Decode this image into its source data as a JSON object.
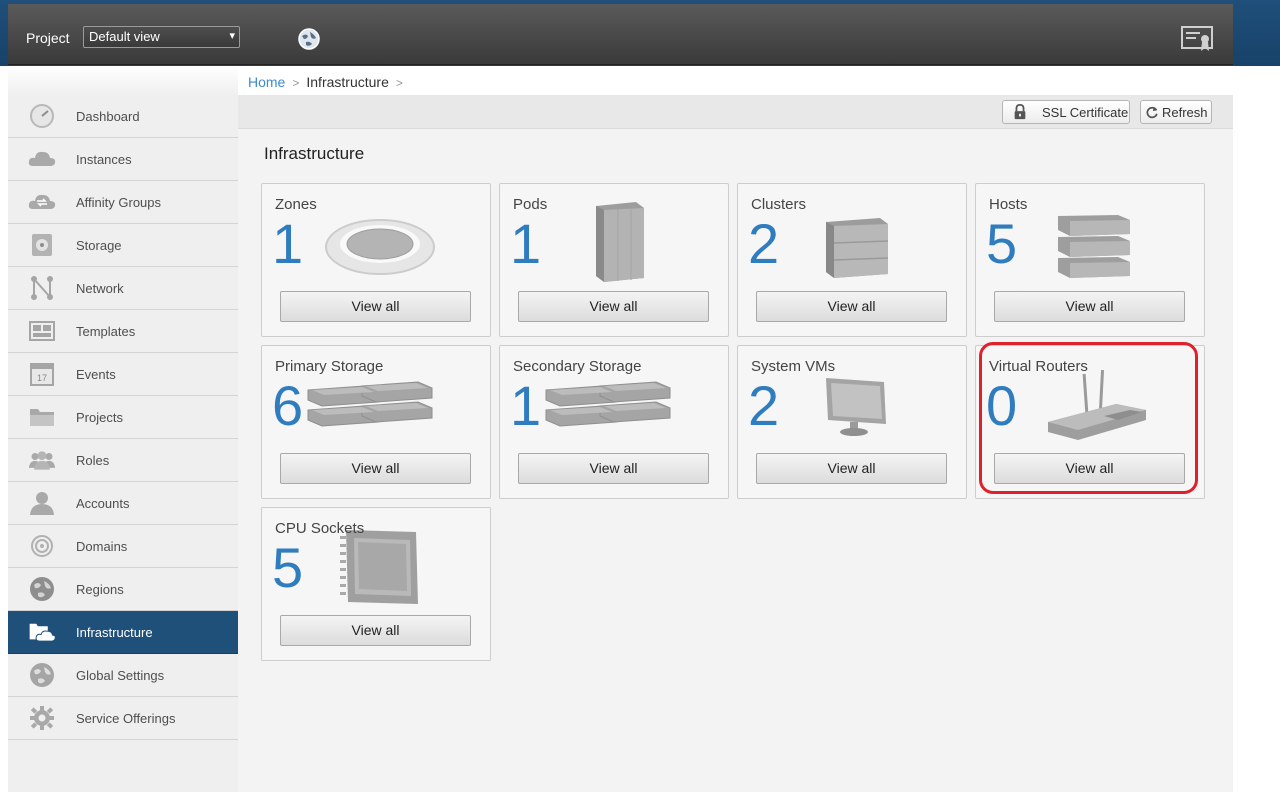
{
  "header": {
    "project_label": "Project",
    "project_select_value": "Default view",
    "caret": "▾",
    "accent_color": "#1e5079"
  },
  "sidebar": {
    "items": [
      {
        "label": "Dashboard",
        "icon": "dashboard-icon"
      },
      {
        "label": "Instances",
        "icon": "cloud-icon"
      },
      {
        "label": "Affinity Groups",
        "icon": "affinity-cloud-icon"
      },
      {
        "label": "Storage",
        "icon": "storage-disk-icon"
      },
      {
        "label": "Network",
        "icon": "network-icon"
      },
      {
        "label": "Templates",
        "icon": "templates-icon"
      },
      {
        "label": "Events",
        "icon": "calendar-icon"
      },
      {
        "label": "Projects",
        "icon": "folder-icon"
      },
      {
        "label": "Roles",
        "icon": "roles-icon"
      },
      {
        "label": "Accounts",
        "icon": "user-icon"
      },
      {
        "label": "Domains",
        "icon": "domains-icon"
      },
      {
        "label": "Regions",
        "icon": "globe-icon"
      },
      {
        "label": "Infrastructure",
        "icon": "infrastructure-icon",
        "active": true
      },
      {
        "label": "Global Settings",
        "icon": "globe-settings-icon"
      },
      {
        "label": "Service Offerings",
        "icon": "gear-icon"
      }
    ],
    "calendar_day": "17"
  },
  "breadcrumb": {
    "home": "Home",
    "current": "Infrastructure",
    "separator": ">"
  },
  "toolbar": {
    "ssl_label": "SSL Certificate",
    "refresh_label": "Refresh"
  },
  "main": {
    "title": "Infrastructure",
    "view_all_label": "View all",
    "tiles": [
      {
        "title": "Zones",
        "count": "1",
        "icon": "zone-disc-icon"
      },
      {
        "title": "Pods",
        "count": "1",
        "icon": "pod-rack-icon"
      },
      {
        "title": "Clusters",
        "count": "2",
        "icon": "cluster-cube-icon"
      },
      {
        "title": "Hosts",
        "count": "5",
        "icon": "host-server-icon"
      },
      {
        "title": "Primary Storage",
        "count": "6",
        "icon": "primary-storage-icon"
      },
      {
        "title": "Secondary Storage",
        "count": "1",
        "icon": "secondary-storage-icon"
      },
      {
        "title": "System VMs",
        "count": "2",
        "icon": "monitor-icon"
      },
      {
        "title": "Virtual Routers",
        "count": "0",
        "icon": "router-icon"
      },
      {
        "title": "CPU Sockets",
        "count": "5",
        "icon": "cpu-chip-icon"
      }
    ]
  },
  "annotation": {
    "highlight_color": "#e0202b"
  }
}
